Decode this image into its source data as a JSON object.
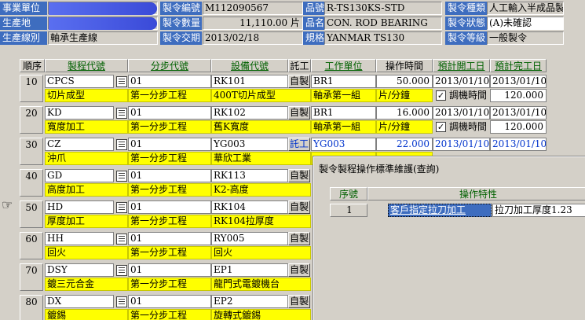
{
  "header": {
    "left": [
      {
        "label": "事業單位",
        "value": ""
      },
      {
        "label": "生產地",
        "value": ""
      },
      {
        "label": "生產線別",
        "value": "軸承生產線"
      }
    ],
    "mid": [
      {
        "label": "製令編號",
        "value": "M112090567"
      },
      {
        "label": "製令數量",
        "value": "11,110.00 片"
      },
      {
        "label": "製令交期",
        "value": "2013/02/18"
      }
    ],
    "right": [
      {
        "label": "品號",
        "value": "R-TS130KS-STD"
      },
      {
        "label": "品名",
        "value": "CON. ROD BEARING"
      },
      {
        "label": "規格",
        "value": "YANMAR TS130"
      }
    ],
    "far": [
      {
        "label": "製令種類",
        "value": "人工輸入半成品製"
      },
      {
        "label": "製令狀態",
        "value": "(A)未確認"
      },
      {
        "label": "製令等級",
        "value": "一般製令"
      }
    ]
  },
  "columns": [
    "順序",
    "製程代號",
    "分步代號",
    "設備代號",
    "託工",
    "工作單位",
    "操作時間",
    "預計開工日",
    "預計完工日"
  ],
  "rows": [
    {
      "seq": "10",
      "proc": "CPCS",
      "proc_name": "切片成型",
      "step": "01",
      "step_name": "第一分步工程",
      "equip": "RK101",
      "equip_name": "400T切片成型",
      "mode": "自製",
      "unit": "BR1",
      "unit_name": "軸承第一組",
      "time": "50.000",
      "time_unit": "片/分鐘",
      "start": "2013/01/10",
      "end": "2013/01/10",
      "adjust_label": "調機時間",
      "adjust": "120.000"
    },
    {
      "seq": "20",
      "proc": "KD",
      "proc_name": "寬度加工",
      "step": "01",
      "step_name": "第一分步工程",
      "equip": "RK102",
      "equip_name": "舊K寬度",
      "mode": "自製",
      "unit": "BR1",
      "unit_name": "軸承第一組",
      "time": "16.000",
      "time_unit": "片/分鐘",
      "start": "2013/01/10",
      "end": "2013/01/10",
      "adjust_label": "調機時間",
      "adjust": "120.000"
    },
    {
      "seq": "30",
      "proc": "CZ",
      "proc_name": "沖爪",
      "step": "01",
      "step_name": "第一分步工程",
      "equip": "YG003",
      "equip_name": "華欣工業",
      "mode": "託工",
      "unit": "YG003",
      "unit_name": "",
      "time": "22.000",
      "time_unit": "",
      "start": "2013/01/10",
      "end": "2013/01/10",
      "adjust_label": "",
      "adjust": ""
    },
    {
      "seq": "40",
      "proc": "GD",
      "proc_name": "高度加工",
      "step": "01",
      "step_name": "第一分步工程",
      "equip": "RK113",
      "equip_name": "K2-高度",
      "mode": "自製"
    },
    {
      "seq": "50",
      "proc": "HD",
      "proc_name": "厚度加工",
      "step": "01",
      "step_name": "第一分步工程",
      "equip": "RK104",
      "equip_name": "RK104拉厚度",
      "mode": "自製"
    },
    {
      "seq": "60",
      "proc": "HH",
      "proc_name": "回火",
      "step": "01",
      "step_name": "第一分步工程",
      "equip": "RY005",
      "equip_name": "回火",
      "mode": "自製"
    },
    {
      "seq": "70",
      "proc": "DSY",
      "proc_name": "鍍三元合金",
      "step": "01",
      "step_name": "第一分步工程",
      "equip": "EP1",
      "equip_name": "龍門式電鍍機台",
      "mode": "自製"
    },
    {
      "seq": "80",
      "proc": "DX",
      "proc_name": "鍍錫",
      "step": "01",
      "step_name": "第一分步工程",
      "equip": "EP2",
      "equip_name": "旋轉式鍍錫",
      "mode": "自製"
    }
  ],
  "dialog": {
    "title": "製令製程操作標準維護(查詢)",
    "cols": [
      "序號",
      "操作特性"
    ],
    "rows": [
      {
        "no": "1",
        "feature": "客戶指定拉刀加工",
        "desc": "拉刀加工厚度1.23"
      }
    ]
  },
  "icons": {
    "row_pointer": "hand-pointer-icon",
    "lookup": "lookup-list-icon"
  }
}
